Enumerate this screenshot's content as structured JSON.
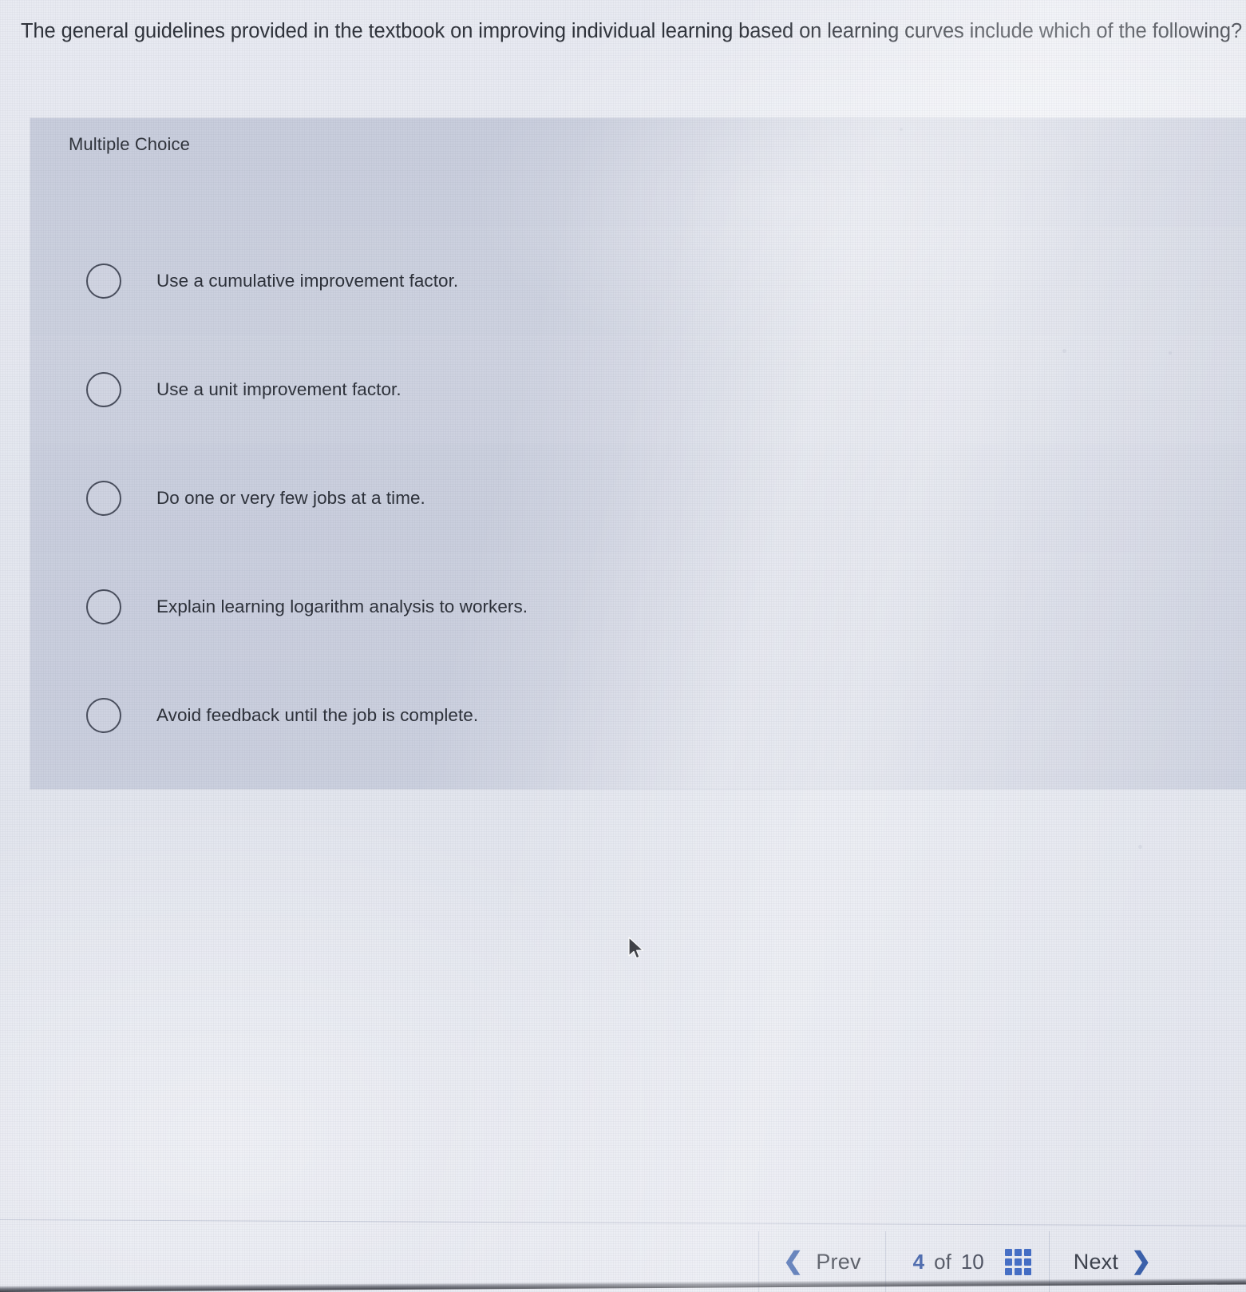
{
  "question": {
    "stem": "The general guidelines provided in the textbook on improving individual learning based on learning curves include which of the following?"
  },
  "card": {
    "type_label": "Multiple Choice",
    "options": [
      {
        "label": "Use a cumulative improvement factor.",
        "selected": false
      },
      {
        "label": "Use a unit improvement factor.",
        "selected": false
      },
      {
        "label": "Do one or very few jobs at a time.",
        "selected": false
      },
      {
        "label": "Explain learning logarithm analysis to workers.",
        "selected": false
      },
      {
        "label": "Avoid feedback until the job is complete.",
        "selected": false
      }
    ]
  },
  "navigation": {
    "prev_label": "Prev",
    "prev_icon": "chevron-left-icon",
    "next_label": "Next",
    "next_icon": "chevron-right-icon",
    "current_question": "4",
    "of_label": "of",
    "total_questions": "10",
    "grid_icon": "grid-3x3-icon"
  },
  "colors": {
    "accent_blue": "#2f5ec0",
    "chevron_blue": "#3159a8",
    "text_primary": "#2e323b",
    "card_background": "#c6cbdb",
    "page_background": "#e4e7ef"
  },
  "cursor": {
    "icon": "mouse-pointer-icon"
  }
}
